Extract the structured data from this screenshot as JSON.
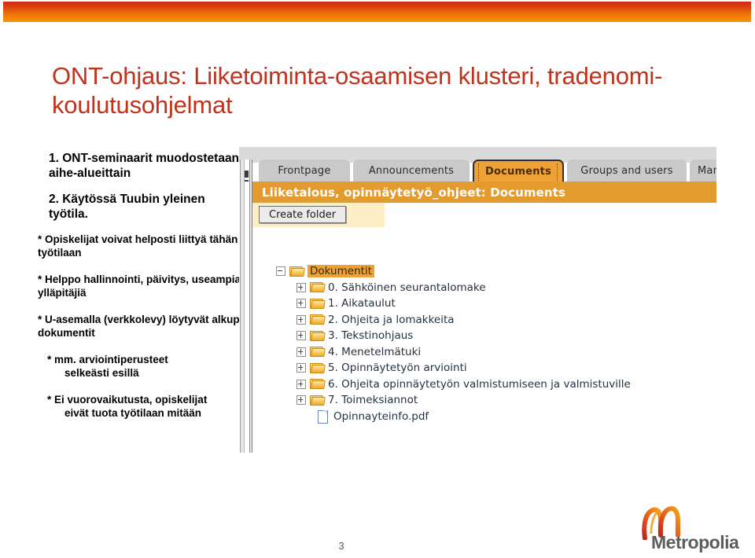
{
  "slide": {
    "title": "ONT-ohjaus: Liiketoiminta-osaamisen klusteri,  tradenomi-koulutusohjelmat",
    "page_number": "3",
    "accent_red": "#c0321b",
    "accent_orange": "#f79400"
  },
  "bullets": [
    {
      "text": "1. ONT-seminaarit muodostetaan aihe-alueittain",
      "style": "num"
    },
    {
      "text": "2. Käytössä Tuubin yleinen työtila.",
      "style": "num"
    },
    {
      "text": "* Opiskelijat voivat helposti liittyä tähän työtilaan",
      "style": "star"
    },
    {
      "text": "* Helppo hallinnointi, päivitys, useampia ylläpitäjiä",
      "style": "star"
    },
    {
      "text": " * U-asemalla (verkkolevy) löytyvät alkup. dokumentit",
      "style": "star"
    },
    {
      "line1": "* mm. arviointiperusteet",
      "line2": "selkeästi esillä",
      "style": "star2"
    },
    {
      "line1": "* Ei vuorovaikutusta, opiskelijat",
      "line2": "eivät tuota työtilaan mitään",
      "style": "star2"
    }
  ],
  "screenshot": {
    "tabs": [
      {
        "label": "Frontpage",
        "active": false
      },
      {
        "label": "Announcements",
        "active": false
      },
      {
        "label": "Documents",
        "active": true
      },
      {
        "label": "Groups and users",
        "active": false
      },
      {
        "label": "Managem",
        "active": false
      }
    ],
    "breadcrumb": "Liiketalous, opinnäytetyö_ohjeet: Documents",
    "toolbar": {
      "create_folder_label": "Create folder"
    },
    "tree": [
      {
        "label": "Dokumentit",
        "level": 0,
        "type": "folder",
        "toggle": "minus",
        "selected": true
      },
      {
        "label": "0. Sähköinen seurantalomake",
        "level": 1,
        "type": "folder",
        "toggle": "plus",
        "selected": false
      },
      {
        "label": "1. Aikataulut",
        "level": 1,
        "type": "folder",
        "toggle": "plus",
        "selected": false
      },
      {
        "label": "2. Ohjeita ja lomakkeita",
        "level": 1,
        "type": "folder",
        "toggle": "plus",
        "selected": false
      },
      {
        "label": "3. Tekstinohjaus",
        "level": 1,
        "type": "folder",
        "toggle": "plus",
        "selected": false
      },
      {
        "label": "4. Menetelmätuki",
        "level": 1,
        "type": "folder",
        "toggle": "plus",
        "selected": false
      },
      {
        "label": "5. Opinnäytetyön arviointi",
        "level": 1,
        "type": "folder",
        "toggle": "plus",
        "selected": false
      },
      {
        "label": "6. Ohjeita opinnäytetyön valmistumiseen ja valmistuville",
        "level": 1,
        "type": "folder",
        "toggle": "plus",
        "selected": false
      },
      {
        "label": "7. Toimeksiannot",
        "level": 1,
        "type": "folder",
        "toggle": "plus",
        "selected": false
      },
      {
        "label": "Opinnayteinfo.pdf",
        "level": 1,
        "type": "file",
        "toggle": "none",
        "selected": false
      }
    ]
  },
  "logo": {
    "text": "Metropolia"
  }
}
